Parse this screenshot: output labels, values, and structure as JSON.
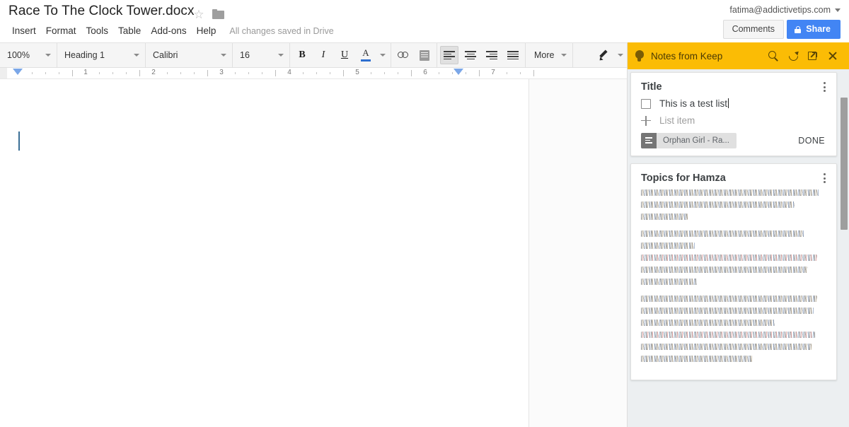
{
  "document": {
    "title": "Race To The Clock Tower.docx",
    "star_icon": "star-outline-icon",
    "folder_icon": "folder-icon",
    "save_status": "All changes saved in Drive",
    "menus": [
      "Insert",
      "Format",
      "Tools",
      "Table",
      "Add-ons",
      "Help"
    ]
  },
  "account": {
    "email": "fatima@addictivetips.com"
  },
  "actions": {
    "comments_label": "Comments",
    "share_label": "Share"
  },
  "toolbar": {
    "zoom": "100%",
    "style": "Heading 1",
    "font": "Calibri",
    "size": "16",
    "bold": "B",
    "italic": "I",
    "underline": "U",
    "text_color": "A",
    "more_label": "More",
    "accent_color": "#4285f4",
    "text_color_swatch": "#2e6fd0"
  },
  "ruler": {
    "numbers": [
      "1",
      "2",
      "3",
      "4",
      "5",
      "6",
      "7"
    ]
  },
  "keep": {
    "header_title": "Notes from Keep",
    "header_color": "#fbbc05",
    "notes": [
      {
        "title": "Title",
        "list_items": [
          "This is a test list"
        ],
        "add_placeholder": "List item",
        "chip_label": "Orphan Girl - Ra...",
        "done_label": "DONE"
      },
      {
        "title": "Topics for Hamza",
        "body_redacted": true,
        "paragraphs": [
          [
            96,
            83,
            25
          ],
          [
            88,
            29,
            95,
            90,
            30
          ],
          [
            95,
            93,
            72,
            94,
            92,
            60
          ]
        ]
      }
    ]
  }
}
